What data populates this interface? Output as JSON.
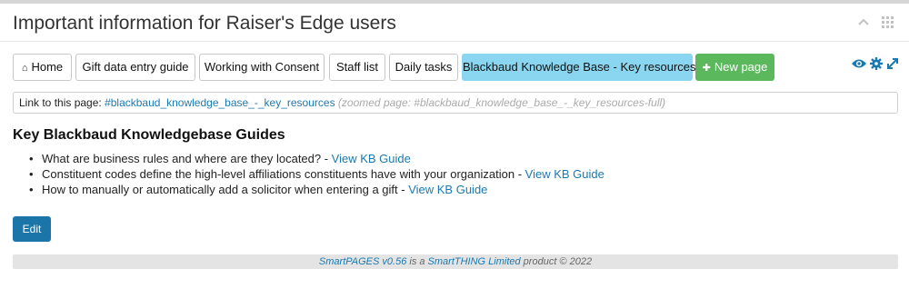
{
  "panel": {
    "title": "Important information for Raiser's Edge users"
  },
  "tabs": [
    {
      "label": "Home",
      "icon": "home-icon"
    },
    {
      "label": "Gift data entry guide"
    },
    {
      "label": "Working with Consent"
    },
    {
      "label": "Staff list"
    },
    {
      "label": "Daily tasks"
    },
    {
      "label": "Blackbaud Knowledge Base - Key resources",
      "active": true
    },
    {
      "label": "New page",
      "icon": "plus-icon"
    }
  ],
  "toolbar": {
    "icons": [
      "eye-icon",
      "gear-icon",
      "expand-icon"
    ]
  },
  "linkbar": {
    "prefix": "Link to this page: ",
    "link": "#blackbaud_knowledge_base_-_key_resources",
    "zoomed": "(zoomed page: #blackbaud_knowledge_base_-_key_resources-full)"
  },
  "content": {
    "heading": "Key Blackbaud Knowledgebase Guides",
    "items": [
      {
        "text": "What are business rules and where are they located? - ",
        "link": "View KB Guide"
      },
      {
        "text": "Constituent codes define the high-level affiliations constituents have with your organization - ",
        "link": "View KB Guide"
      },
      {
        "text": "How to manually or automatically add a solicitor when entering a gift - ",
        "link": "View KB Guide"
      }
    ]
  },
  "edit_label": "Edit",
  "footer": {
    "product": "SmartPAGES v0.56",
    "mid": " is a ",
    "company": "SmartTHING Limited",
    "suffix": " product © 2022"
  },
  "colors": {
    "active_tab": "#8ad6f0",
    "new_page": "#5cb85c",
    "link": "#1a7ab0",
    "edit_button": "#1b75a8"
  }
}
